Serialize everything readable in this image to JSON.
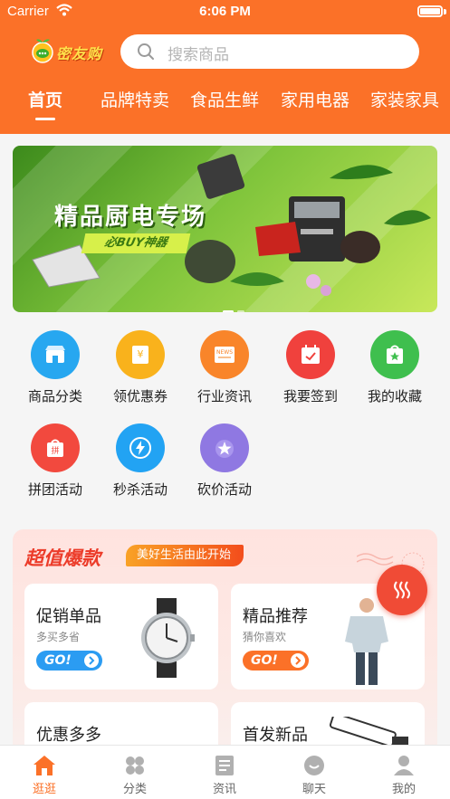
{
  "status_bar": {
    "carrier": "Carrier",
    "time": "6:06 PM"
  },
  "header": {
    "logo_text": "密友购",
    "search_placeholder": "搜索商品",
    "tabs": [
      {
        "label": "首页",
        "active": true
      },
      {
        "label": "品牌特卖"
      },
      {
        "label": "食品生鲜"
      },
      {
        "label": "家用电器"
      },
      {
        "label": "家装家具"
      }
    ]
  },
  "banner": {
    "title": "精品厨电专场",
    "subtitle": "必BUY神器"
  },
  "categories": [
    {
      "label": "商品分类",
      "icon": "store-icon",
      "color": "#27a7f0"
    },
    {
      "label": "领优惠券",
      "icon": "coupon-icon",
      "color": "#f9b21c"
    },
    {
      "label": "行业资讯",
      "icon": "news-icon",
      "color": "#f9852a"
    },
    {
      "label": "我要签到",
      "icon": "calendar-check-icon",
      "color": "#f0413d"
    },
    {
      "label": "我的收藏",
      "icon": "favorite-bag-icon",
      "color": "#3fbf4e"
    },
    {
      "label": "拼团活动",
      "icon": "group-bag-icon",
      "color": "#f2493e"
    },
    {
      "label": "秒杀活动",
      "icon": "flash-sale-icon",
      "color": "#22a3f3"
    },
    {
      "label": "砍价活动",
      "icon": "medal-star-icon",
      "color": "#8f78e2"
    }
  ],
  "promo": {
    "title": "超值爆款",
    "tagline": "美好生活由此开始",
    "cards": [
      {
        "title": "促销单品",
        "subtitle": "多买多省",
        "button": "GO!",
        "button_color": "#2b9cf2",
        "image": "watch"
      },
      {
        "title": "精品推荐",
        "subtitle": "猜你喜欢",
        "button": "GO!",
        "button_color": "#fb7128",
        "image": "shirt-model"
      },
      {
        "title": "优惠多多",
        "subtitle": "",
        "image": ""
      },
      {
        "title": "首发新品",
        "subtitle": "",
        "image": "telescope"
      }
    ]
  },
  "bottom_nav": [
    {
      "label": "逛逛",
      "icon": "home-icon",
      "active": true
    },
    {
      "label": "分类",
      "icon": "category-grid-icon"
    },
    {
      "label": "资讯",
      "icon": "news-doc-icon"
    },
    {
      "label": "聊天",
      "icon": "chat-icon"
    },
    {
      "label": "我的",
      "icon": "profile-icon"
    }
  ],
  "colors": {
    "brand": "#fb7128",
    "promo_red": "#ec3c2a"
  }
}
